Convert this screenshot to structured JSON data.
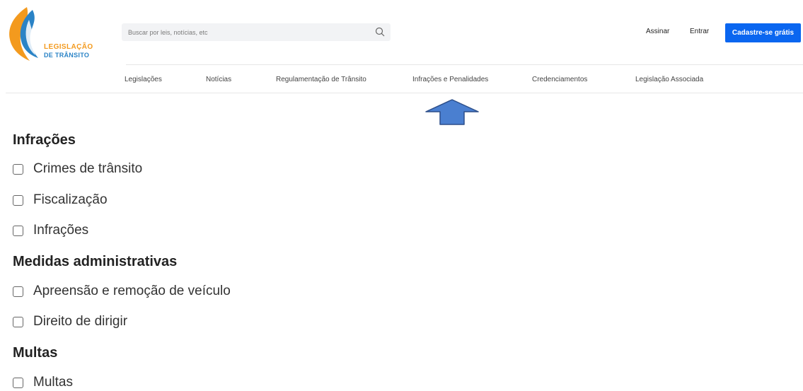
{
  "header": {
    "logo": {
      "line1": "LEGISLAÇÃO",
      "line2": "DE TRÂNSITO",
      "icon": "road-swoosh-logo"
    },
    "search": {
      "placeholder": "Buscar por leis, notícias, etc",
      "icon": "search-icon"
    },
    "links": {
      "subscribe": "Assinar",
      "login": "Entrar"
    },
    "signup_button": "Cadastre-se grátis"
  },
  "nav": {
    "items": [
      {
        "label": "Legislações"
      },
      {
        "label": "Notícias"
      },
      {
        "label": "Regulamentação de Trânsito"
      },
      {
        "label": "Infrações e Penalidades"
      },
      {
        "label": "Credenciamentos"
      },
      {
        "label": "Legislação Associada"
      }
    ]
  },
  "filters": {
    "sections": [
      {
        "heading": "Infrações",
        "items": [
          {
            "label": "Crimes de trânsito"
          },
          {
            "label": "Fiscalização"
          },
          {
            "label": "Infrações"
          }
        ]
      },
      {
        "heading": "Medidas administrativas",
        "items": [
          {
            "label": "Apreensão e remoção de veículo"
          },
          {
            "label": "Direito de dirigir"
          }
        ]
      },
      {
        "heading": "Multas",
        "items": [
          {
            "label": "Multas"
          }
        ]
      }
    ]
  },
  "colors": {
    "accent": "#0a66f0",
    "logo_orange": "#f39a1e",
    "logo_blue": "#2a83c6",
    "arrow_fill": "#4a7fd0",
    "arrow_stroke": "#2d4f8a"
  }
}
